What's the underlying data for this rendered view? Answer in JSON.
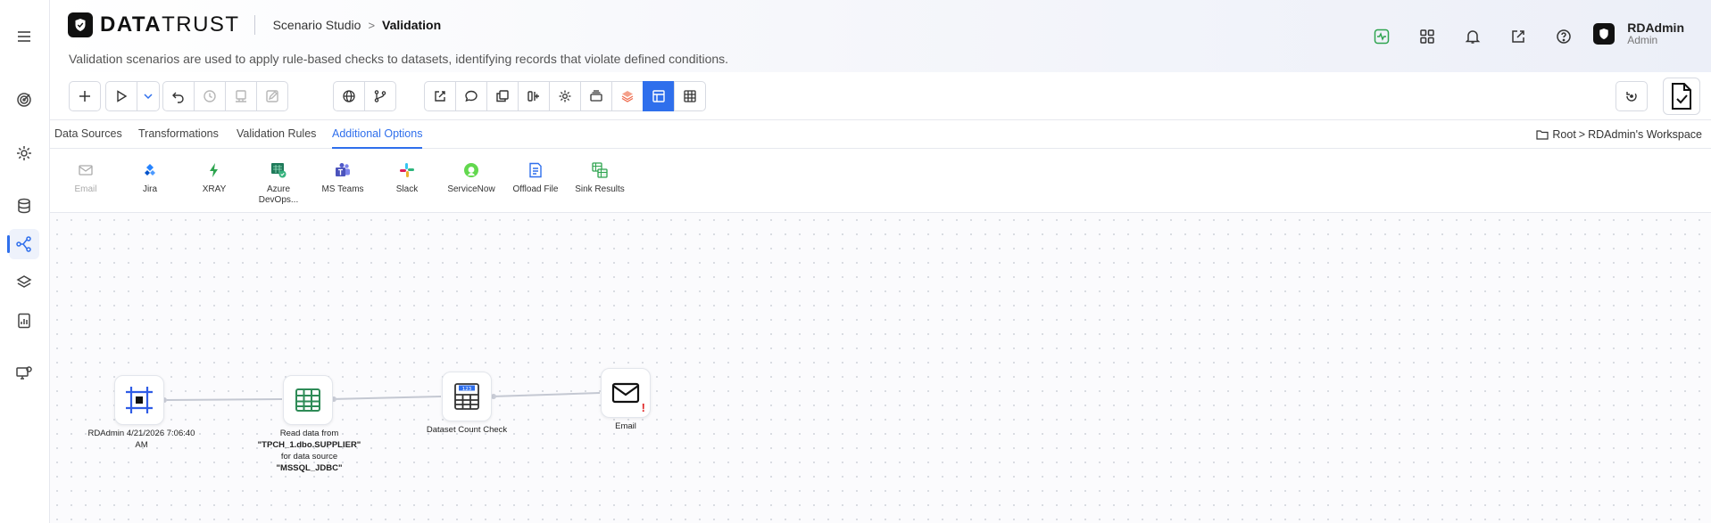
{
  "app": {
    "logo_bold": "DATA",
    "logo_light": "TRUST",
    "breadcrumb_parent": "Scenario Studio",
    "breadcrumb_chevron": ">",
    "breadcrumb_current": "Validation",
    "subtitle": "Validation scenarios are used to apply rule-based checks to datasets, identifying records that violate defined conditions."
  },
  "header_icons": [
    "activity-icon",
    "apps-grid-icon",
    "bell-icon",
    "external-link-icon",
    "help-icon"
  ],
  "user": {
    "name": "RDAdmin",
    "role": "Admin"
  },
  "rail_items": [
    "menu-icon",
    "target-icon",
    "gear-icon",
    "database-icon",
    "flow-icon",
    "layers-icon",
    "report-icon",
    "monitor-icon"
  ],
  "tabs": [
    {
      "label": "Data Sources"
    },
    {
      "label": "Transformations"
    },
    {
      "label": "Validation Rules"
    },
    {
      "label": "Additional Options",
      "active": true
    }
  ],
  "workspace": {
    "root": "Root",
    "chevron": ">",
    "name": "RDAdmin's Workspace"
  },
  "options": [
    {
      "label": "Email",
      "disabled": true
    },
    {
      "label": "Jira"
    },
    {
      "label": "XRAY"
    },
    {
      "label": "Azure DevOps..."
    },
    {
      "label": "MS Teams"
    },
    {
      "label": "Slack"
    },
    {
      "label": "ServiceNow"
    },
    {
      "label": "Offload File"
    },
    {
      "label": "Sink Results"
    }
  ],
  "nodes": [
    {
      "label": "RDAdmin 4/21/2026 7:06:40 AM"
    },
    {
      "label_prefix": "Read data from ",
      "label_table": "\"TPCH_1.dbo.SUPPLIER\"",
      "label_mid": " for data source ",
      "label_source": "\"MSSQL_JDBC\""
    },
    {
      "label": "Dataset Count Check"
    },
    {
      "label": "Email",
      "error_mark": "!"
    }
  ],
  "colors": {
    "accent": "#2f6fec",
    "jira": "#2684ff",
    "xray": "#2ea44f",
    "teams": "#5059c9",
    "servicenow": "#62d84e",
    "error": "#e02424"
  }
}
